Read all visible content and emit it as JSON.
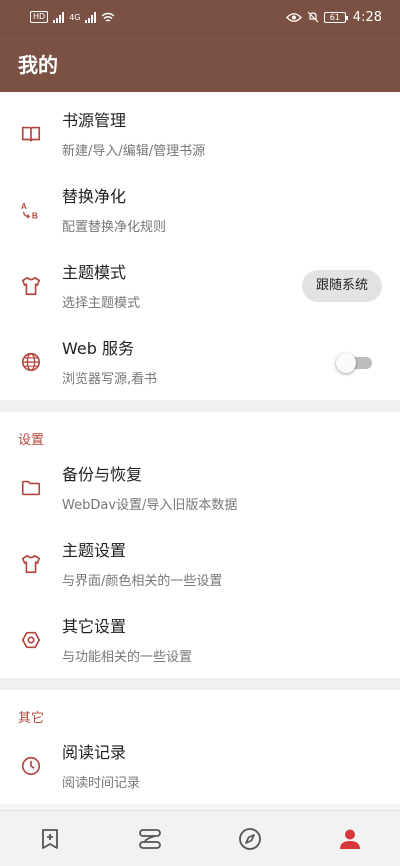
{
  "status_bar": {
    "left_chips": [
      "HD",
      "4G"
    ],
    "battery": "61",
    "time": "4:28"
  },
  "appbar": {
    "title": "我的"
  },
  "groups": [
    {
      "items": [
        {
          "title": "书源管理",
          "subtitle": "新建/导入/编辑/管理书源",
          "icon": "book-open-icon"
        },
        {
          "title": "替换净化",
          "subtitle": "配置替换净化规则",
          "icon": "replace-ab-icon"
        },
        {
          "title": "主题模式",
          "subtitle": "选择主题模式",
          "icon": "tshirt-icon",
          "button": "跟随系统"
        },
        {
          "title": "Web 服务",
          "subtitle": "浏览器写源,看书",
          "icon": "globe-icon",
          "switch": false
        }
      ]
    },
    {
      "header": "设置",
      "items": [
        {
          "title": "备份与恢复",
          "subtitle": "WebDav设置/导入旧版本数据",
          "icon": "folder-icon"
        },
        {
          "title": "主题设置",
          "subtitle": "与界面/颜色相关的一些设置",
          "icon": "tshirt-icon"
        },
        {
          "title": "其它设置",
          "subtitle": "与功能相关的一些设置",
          "icon": "hexagon-icon"
        }
      ]
    },
    {
      "header": "其它",
      "items": [
        {
          "title": "阅读记录",
          "subtitle": "阅读时间记录",
          "icon": "clock-icon"
        }
      ]
    }
  ],
  "bottom_nav": [
    {
      "icon": "bookmark-add-icon",
      "active": false
    },
    {
      "icon": "explore-source-icon",
      "active": false
    },
    {
      "icon": "compass-icon",
      "active": false
    },
    {
      "icon": "person-icon",
      "active": true
    }
  ],
  "colors": {
    "primary": "#7a5143",
    "accent": "#b3473f",
    "nav_active": "#d6373a",
    "nav_inactive": "#555555"
  }
}
